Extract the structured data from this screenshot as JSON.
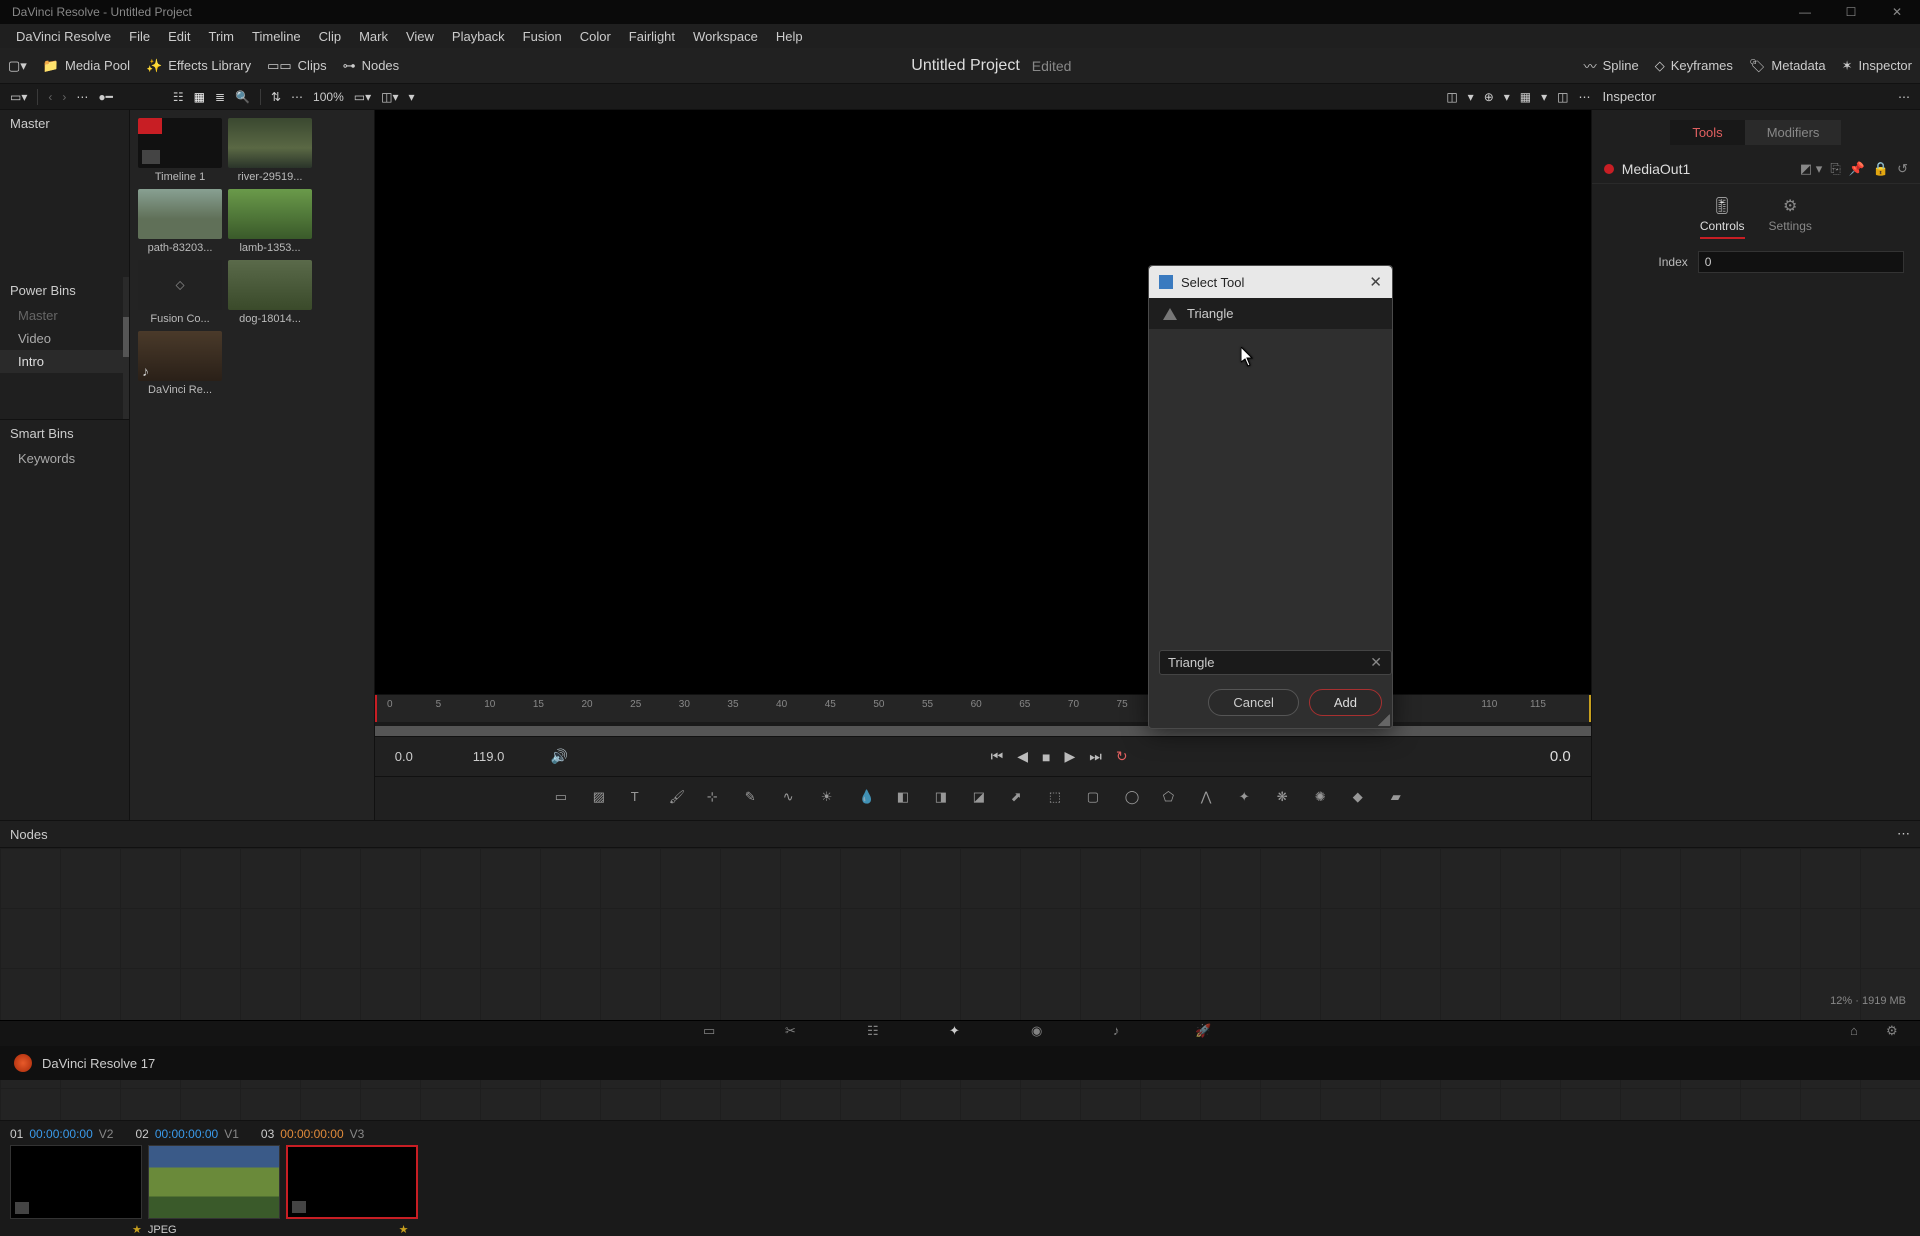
{
  "titlebar": {
    "text": "DaVinci Resolve - Untitled Project"
  },
  "menu": [
    "DaVinci Resolve",
    "File",
    "Edit",
    "Trim",
    "Timeline",
    "Clip",
    "Mark",
    "View",
    "Playback",
    "Fusion",
    "Color",
    "Fairlight",
    "Workspace",
    "Help"
  ],
  "toolbar": {
    "left": [
      {
        "id": "dropdown-icon",
        "label": ""
      },
      {
        "id": "media-pool",
        "label": "Media Pool"
      },
      {
        "id": "effects-library",
        "label": "Effects Library"
      },
      {
        "id": "clips",
        "label": "Clips"
      },
      {
        "id": "nodes",
        "label": "Nodes"
      }
    ],
    "project_title": "Untitled Project",
    "project_status": "Edited",
    "right": [
      {
        "id": "spline",
        "label": "Spline"
      },
      {
        "id": "keyframes",
        "label": "Keyframes"
      },
      {
        "id": "metadata",
        "label": "Metadata"
      },
      {
        "id": "inspector",
        "label": "Inspector"
      }
    ]
  },
  "subtoolbar": {
    "zoom": "100%"
  },
  "bins": {
    "master": "Master",
    "power_title": "Power Bins",
    "power_items": [
      "Master",
      "Video",
      "Intro"
    ],
    "smart_title": "Smart Bins",
    "smart_items": [
      "Keywords"
    ]
  },
  "media": [
    {
      "id": "timeline1",
      "label": "Timeline 1",
      "cls": "timeline"
    },
    {
      "id": "river",
      "label": "river-29519...",
      "cls": "river"
    },
    {
      "id": "path",
      "label": "path-83203...",
      "cls": "path"
    },
    {
      "id": "lamb",
      "label": "lamb-1353...",
      "cls": "lamb"
    },
    {
      "id": "fusioncomp",
      "label": "Fusion Co...",
      "cls": "comp"
    },
    {
      "id": "dog",
      "label": "dog-18014...",
      "cls": "dog"
    },
    {
      "id": "davincire",
      "label": "DaVinci Re...",
      "cls": "wood"
    }
  ],
  "ruler_ticks": [
    "0",
    "5",
    "10",
    "15",
    "20",
    "25",
    "30",
    "35",
    "40",
    "45",
    "50",
    "55",
    "60",
    "65",
    "70",
    "75",
    "110",
    "115"
  ],
  "transport": {
    "in": "0.0",
    "out": "119.0",
    "right_tc": "0.0"
  },
  "nodes_panel": {
    "title": "Nodes"
  },
  "clips": {
    "rows": [
      {
        "num": "01",
        "tc": "00:00:00:00",
        "track": "V2",
        "tc_cls": "clip-tc"
      },
      {
        "num": "02",
        "tc": "00:00:00:00",
        "track": "V1",
        "tc_cls": "clip-tc"
      },
      {
        "num": "03",
        "tc": "00:00:00:00",
        "track": "V3",
        "tc_cls": "clip-tc orange"
      }
    ],
    "meta_label": "JPEG"
  },
  "inspector": {
    "title": "Inspector",
    "tabs": {
      "tools": "Tools",
      "modifiers": "Modifiers"
    },
    "node": "MediaOut1",
    "subtabs": {
      "controls": "Controls",
      "settings": "Settings"
    },
    "index_label": "Index",
    "index_value": "0"
  },
  "dialog": {
    "title": "Select Tool",
    "result": "Triangle",
    "search": "Triangle",
    "cancel": "Cancel",
    "add": "Add"
  },
  "status": {
    "app": "DaVinci Resolve 17",
    "mem": "12% · 1919 MB"
  }
}
